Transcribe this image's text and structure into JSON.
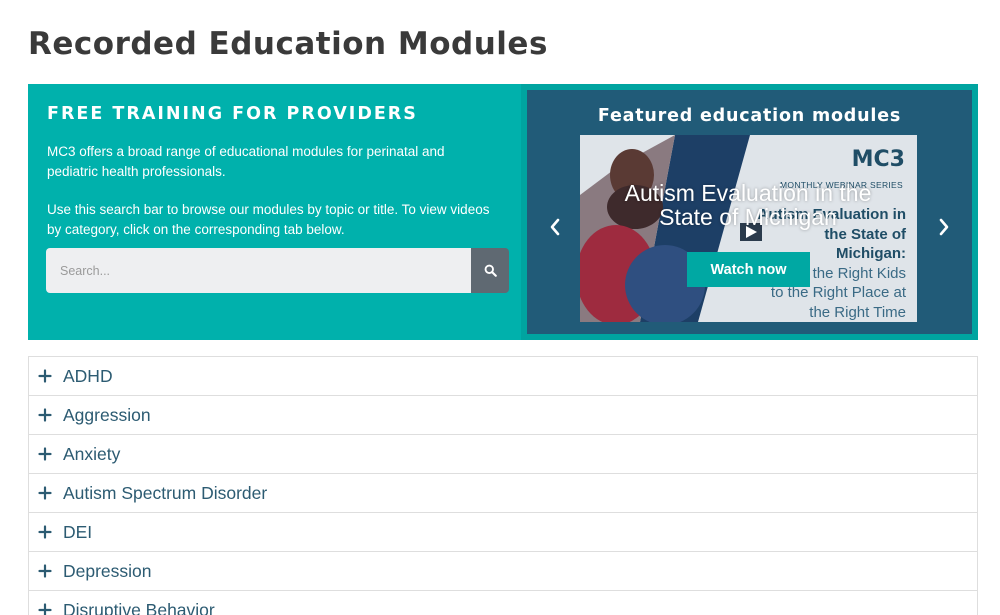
{
  "page": {
    "title": "Recorded Education Modules"
  },
  "promo": {
    "heading": "FREE TRAINING FOR PROVIDERS",
    "paragraph1": "MC3 offers a broad range of educational modules for perinatal and pediatric health professionals.",
    "paragraph2": "Use this search bar to browse our modules by topic or title. To view videos by category, click on the corresponding tab below."
  },
  "search": {
    "placeholder": "Search...",
    "value": "",
    "button_icon": "search-icon"
  },
  "featured": {
    "title": "Featured education modules",
    "prev_icon": "chevron-left-icon",
    "next_icon": "chevron-right-icon",
    "slide": {
      "logo": "MC3",
      "series": "MONTHLY WEBINAR SERIES",
      "bg_line1": "Autism Evaluation in",
      "bg_line2": "the State of Michigan:",
      "bg_line3": "Getting the Right Kids",
      "bg_line4": "to the Right Place at",
      "bg_line5": "the Right Time",
      "overlay_title": "Autism Evaluation in the State of Michigan",
      "button_label": "Watch now"
    }
  },
  "categories": [
    {
      "label": "ADHD"
    },
    {
      "label": "Aggression"
    },
    {
      "label": "Anxiety"
    },
    {
      "label": "Autism Spectrum Disorder"
    },
    {
      "label": "DEI"
    },
    {
      "label": "Depression"
    },
    {
      "label": "Disruptive Behavior"
    }
  ],
  "colors": {
    "teal": "#00b1ac",
    "navy": "#215b78",
    "search_button": "#5f6972",
    "category_text": "#2c5b72"
  }
}
